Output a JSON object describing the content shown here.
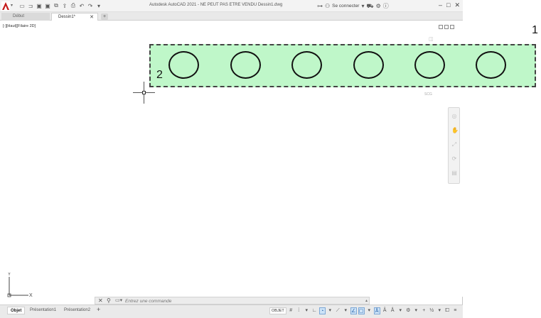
{
  "window": {
    "title": "Autodesk AutoCAD 2021 - NE PEUT PAS ETRE VENDU    Dessin1.dwg",
    "signin_label": "Se connecter"
  },
  "file_tabs": [
    {
      "label": "Début"
    },
    {
      "label": "Dessin1*"
    }
  ],
  "viewport": {
    "label": "[-][Haut][Filaire 2D]",
    "scu_label": "SCG"
  },
  "annotations": {
    "one": "1",
    "two": "2"
  },
  "ucs": {
    "x_label": "X",
    "y_label": "Y"
  },
  "command_line": {
    "placeholder": "Entrez une commande"
  },
  "layout_tabs": [
    {
      "label": "Objet"
    },
    {
      "label": "Présentation1"
    },
    {
      "label": "Présentation2"
    }
  ],
  "status": {
    "objet_label": "OBJET"
  },
  "drawing": {
    "circle_count": 6,
    "selection_fill": "#bff7c9"
  },
  "colors": {
    "accent": "#c41a1a",
    "selection": "#bff7c9"
  }
}
